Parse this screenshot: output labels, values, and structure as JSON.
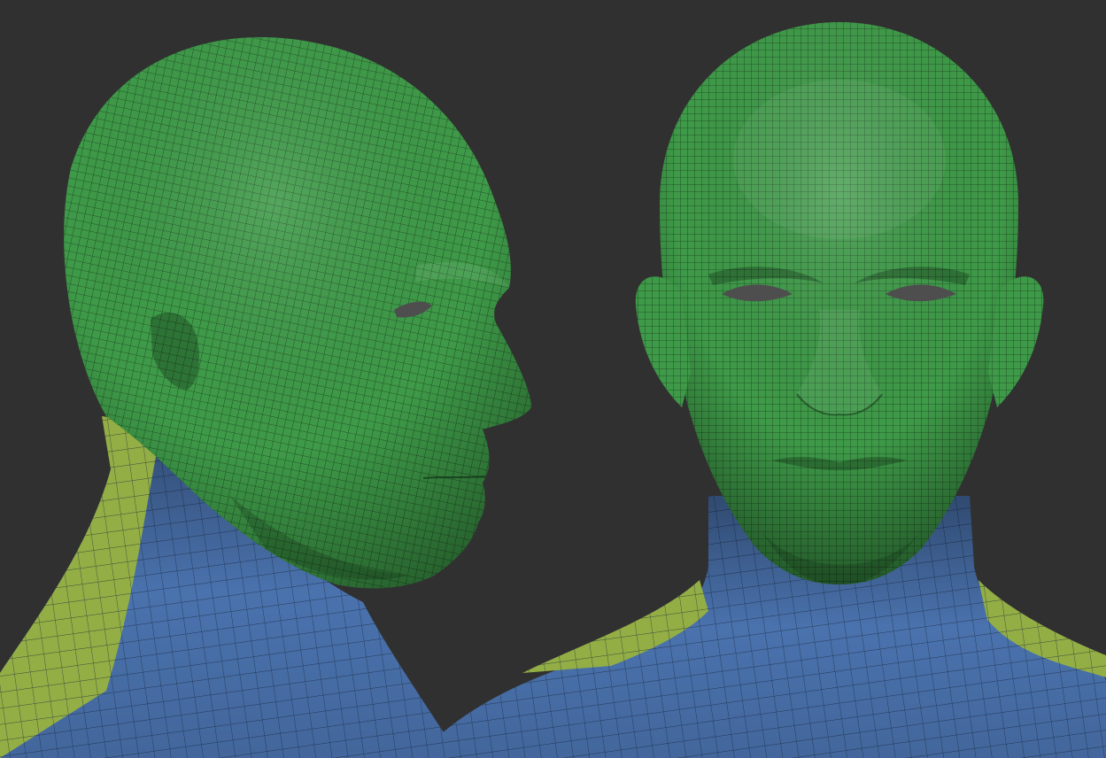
{
  "scene": {
    "background": "#303030",
    "views": [
      {
        "name": "side-profile-view"
      },
      {
        "name": "front-view"
      }
    ]
  },
  "colors": {
    "head": "#3e9a48",
    "head_light": "#58b45c",
    "head_dark": "#1f5a25",
    "neck_shoulders": "#4a72ad",
    "neck_dark": "#2f4f80",
    "trapezius": "#93ae45",
    "wire": "#0f2212",
    "eyes": "#4e4e4e"
  }
}
